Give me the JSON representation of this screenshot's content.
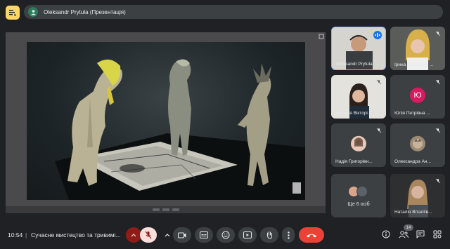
{
  "app": {
    "presenter_label": "Oleksandr Prytula (Презентація)",
    "meeting_time": "10:54",
    "meeting_separator": "|",
    "meeting_title": "Сучасне мистецтво та тривимі..."
  },
  "participants": [
    {
      "name": "Oleksandr Prytula",
      "speaking": true,
      "muted": false
    },
    {
      "name": "Ірина Віталіївна ...",
      "muted": true
    },
    {
      "name": "Вікторія Вікторі...",
      "muted": true
    },
    {
      "name": "Юлія Петрівна ...",
      "muted": true,
      "initial": "Ю",
      "color": "#d81b60"
    },
    {
      "name": "Надія Григорівн...",
      "muted": true
    },
    {
      "name": "Олександра Ан...",
      "muted": true
    },
    {
      "name": "Ще 6 осіб"
    },
    {
      "name": "Наталія Віталіїв...",
      "muted": true
    }
  ],
  "controls": {
    "people_count": "14"
  },
  "icons": {
    "menu": "lines-icon",
    "mic": "mic-off-icon",
    "camera": "camera-icon",
    "captions": "captions-icon",
    "emoji": "emoji-icon",
    "present": "present-icon",
    "hand": "raise-hand-icon",
    "more": "more-vert-icon",
    "end": "end-call-icon",
    "info": "info-icon",
    "people": "people-icon",
    "chat": "chat-icon",
    "activities": "activities-icon"
  },
  "colors": {
    "accent_yellow": "#fdd663",
    "end_call": "#ea4335",
    "mic_off_bg": "#f9dedc",
    "speaking_blue": "#1a73e8"
  }
}
